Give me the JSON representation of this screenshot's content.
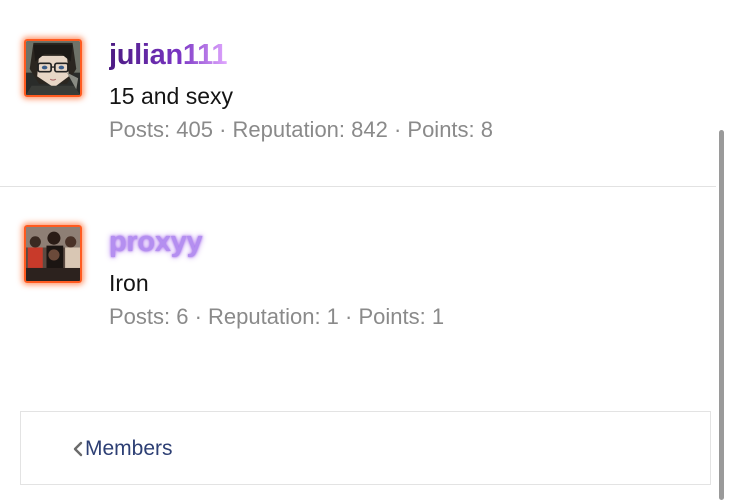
{
  "members": [
    {
      "username": "julian111",
      "title": "15 and sexy",
      "stats": "Posts: 405 · Reputation: 842 · Points: 8",
      "avatar_icon": "anime-glasses-avatar"
    },
    {
      "username": "proxyy",
      "title": "Iron",
      "stats": "Posts: 6 · Reputation: 1 · Points: 1",
      "avatar_icon": "group-photo-avatar"
    }
  ],
  "nav": {
    "back_label": "Members",
    "chevron_icon": "chevron-left-icon"
  },
  "colors": {
    "avatar_border": "#ff5a1f",
    "username_1_gradient": [
      "#4b1a82",
      "#e1a8ff"
    ],
    "username_2": "#b48ff0",
    "stats_text": "#8a8a8a",
    "nav_label": "#2d3f74"
  }
}
